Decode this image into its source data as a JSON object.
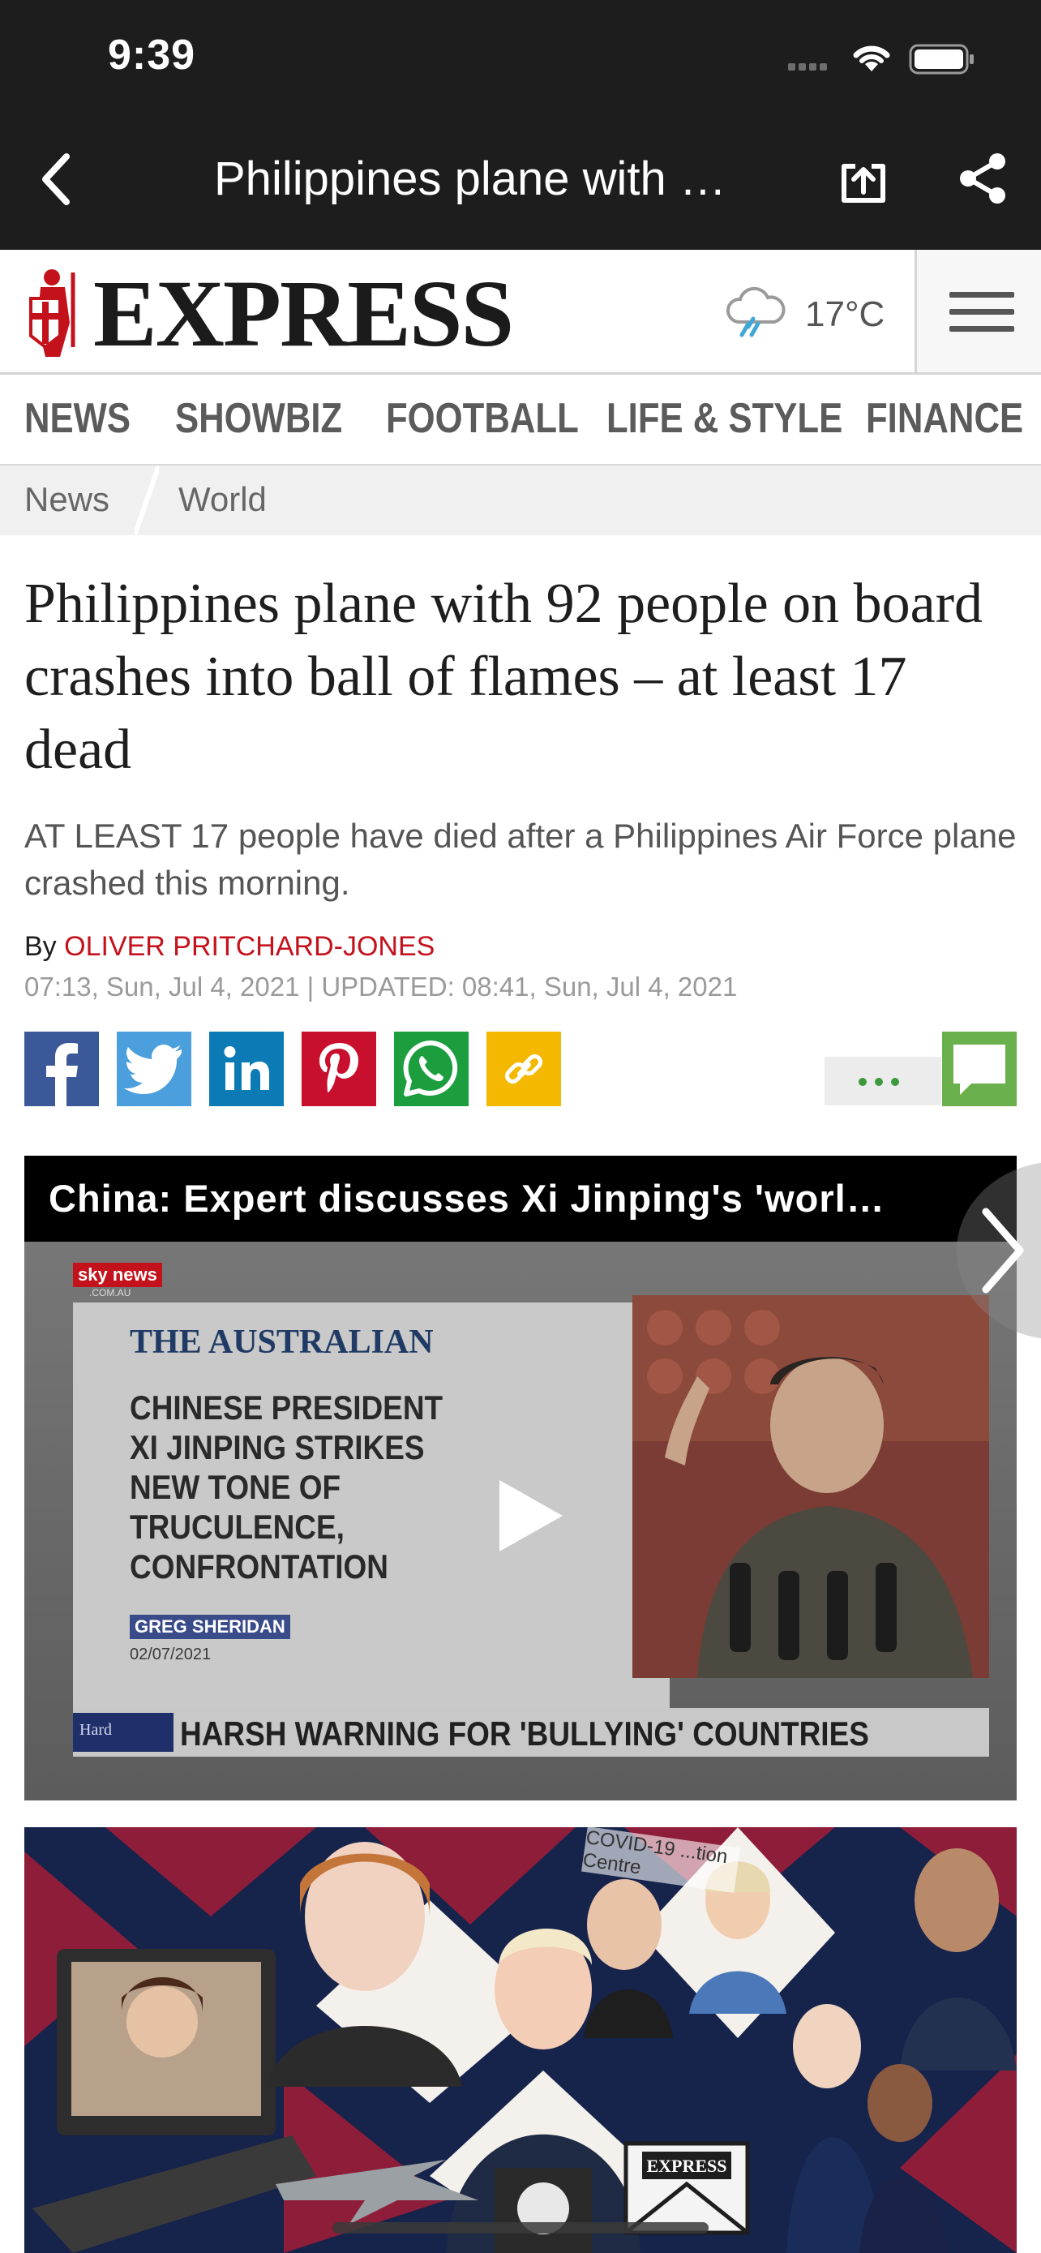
{
  "status_bar": {
    "time": "9:39"
  },
  "browser": {
    "title": "Philippines plane with …"
  },
  "site": {
    "name": "EXPRESS",
    "temperature": "17°C",
    "weather_icon": "rain-cloud-icon"
  },
  "sections": [
    "NEWS",
    "SHOWBIZ",
    "FOOTBALL",
    "LIFE & STYLE",
    "FINANCE"
  ],
  "breadcrumb": {
    "section": "News",
    "subsection": "World"
  },
  "article": {
    "headline": "Philippines plane with 92 people on board crashes into ball of flames – at least 17 dead",
    "standfirst": "AT LEAST 17 people have died after a Philippines Air Force plane crashed this morning.",
    "by_label": "By",
    "author": "OLIVER PRITCHARD-JONES",
    "timestamp": "07:13, Sun, Jul 4, 2021 | UPDATED: 08:41, Sun, Jul 4, 2021"
  },
  "share_buttons": [
    {
      "name": "facebook",
      "color": "#3b5998"
    },
    {
      "name": "twitter",
      "color": "#4b9fdc"
    },
    {
      "name": "linkedin",
      "color": "#0b7ab5"
    },
    {
      "name": "pinterest",
      "color": "#c8102e"
    },
    {
      "name": "whatsapp",
      "color": "#1c9e3f"
    },
    {
      "name": "copy-link",
      "color": "#f4b800"
    }
  ],
  "video": {
    "title": "China: Expert discusses Xi Jinping's 'worl…",
    "channel_logo": "sky news",
    "channel_sub": ".COM.AU",
    "paper_name": "THE AUSTRALIAN",
    "story_lines": [
      "CHINESE PRESIDENT",
      "XI JINPING STRIKES",
      "NEW TONE OF",
      "TRUCULENCE,",
      "CONFRONTATION"
    ],
    "author_tag": "GREG SHERIDAN",
    "story_date": "02/07/2021",
    "chyron_logo": "Hard",
    "chyron": "HARSH WARNING FOR 'BULLYING' COUNTRIES"
  },
  "promo": {
    "badge": "EXPRESS",
    "banner": "COVID-19 ...tion Centre"
  },
  "colors": {
    "bar_bg": "#1d1d1d",
    "author_red": "#c4121d",
    "comments_green": "#6ab04c"
  }
}
